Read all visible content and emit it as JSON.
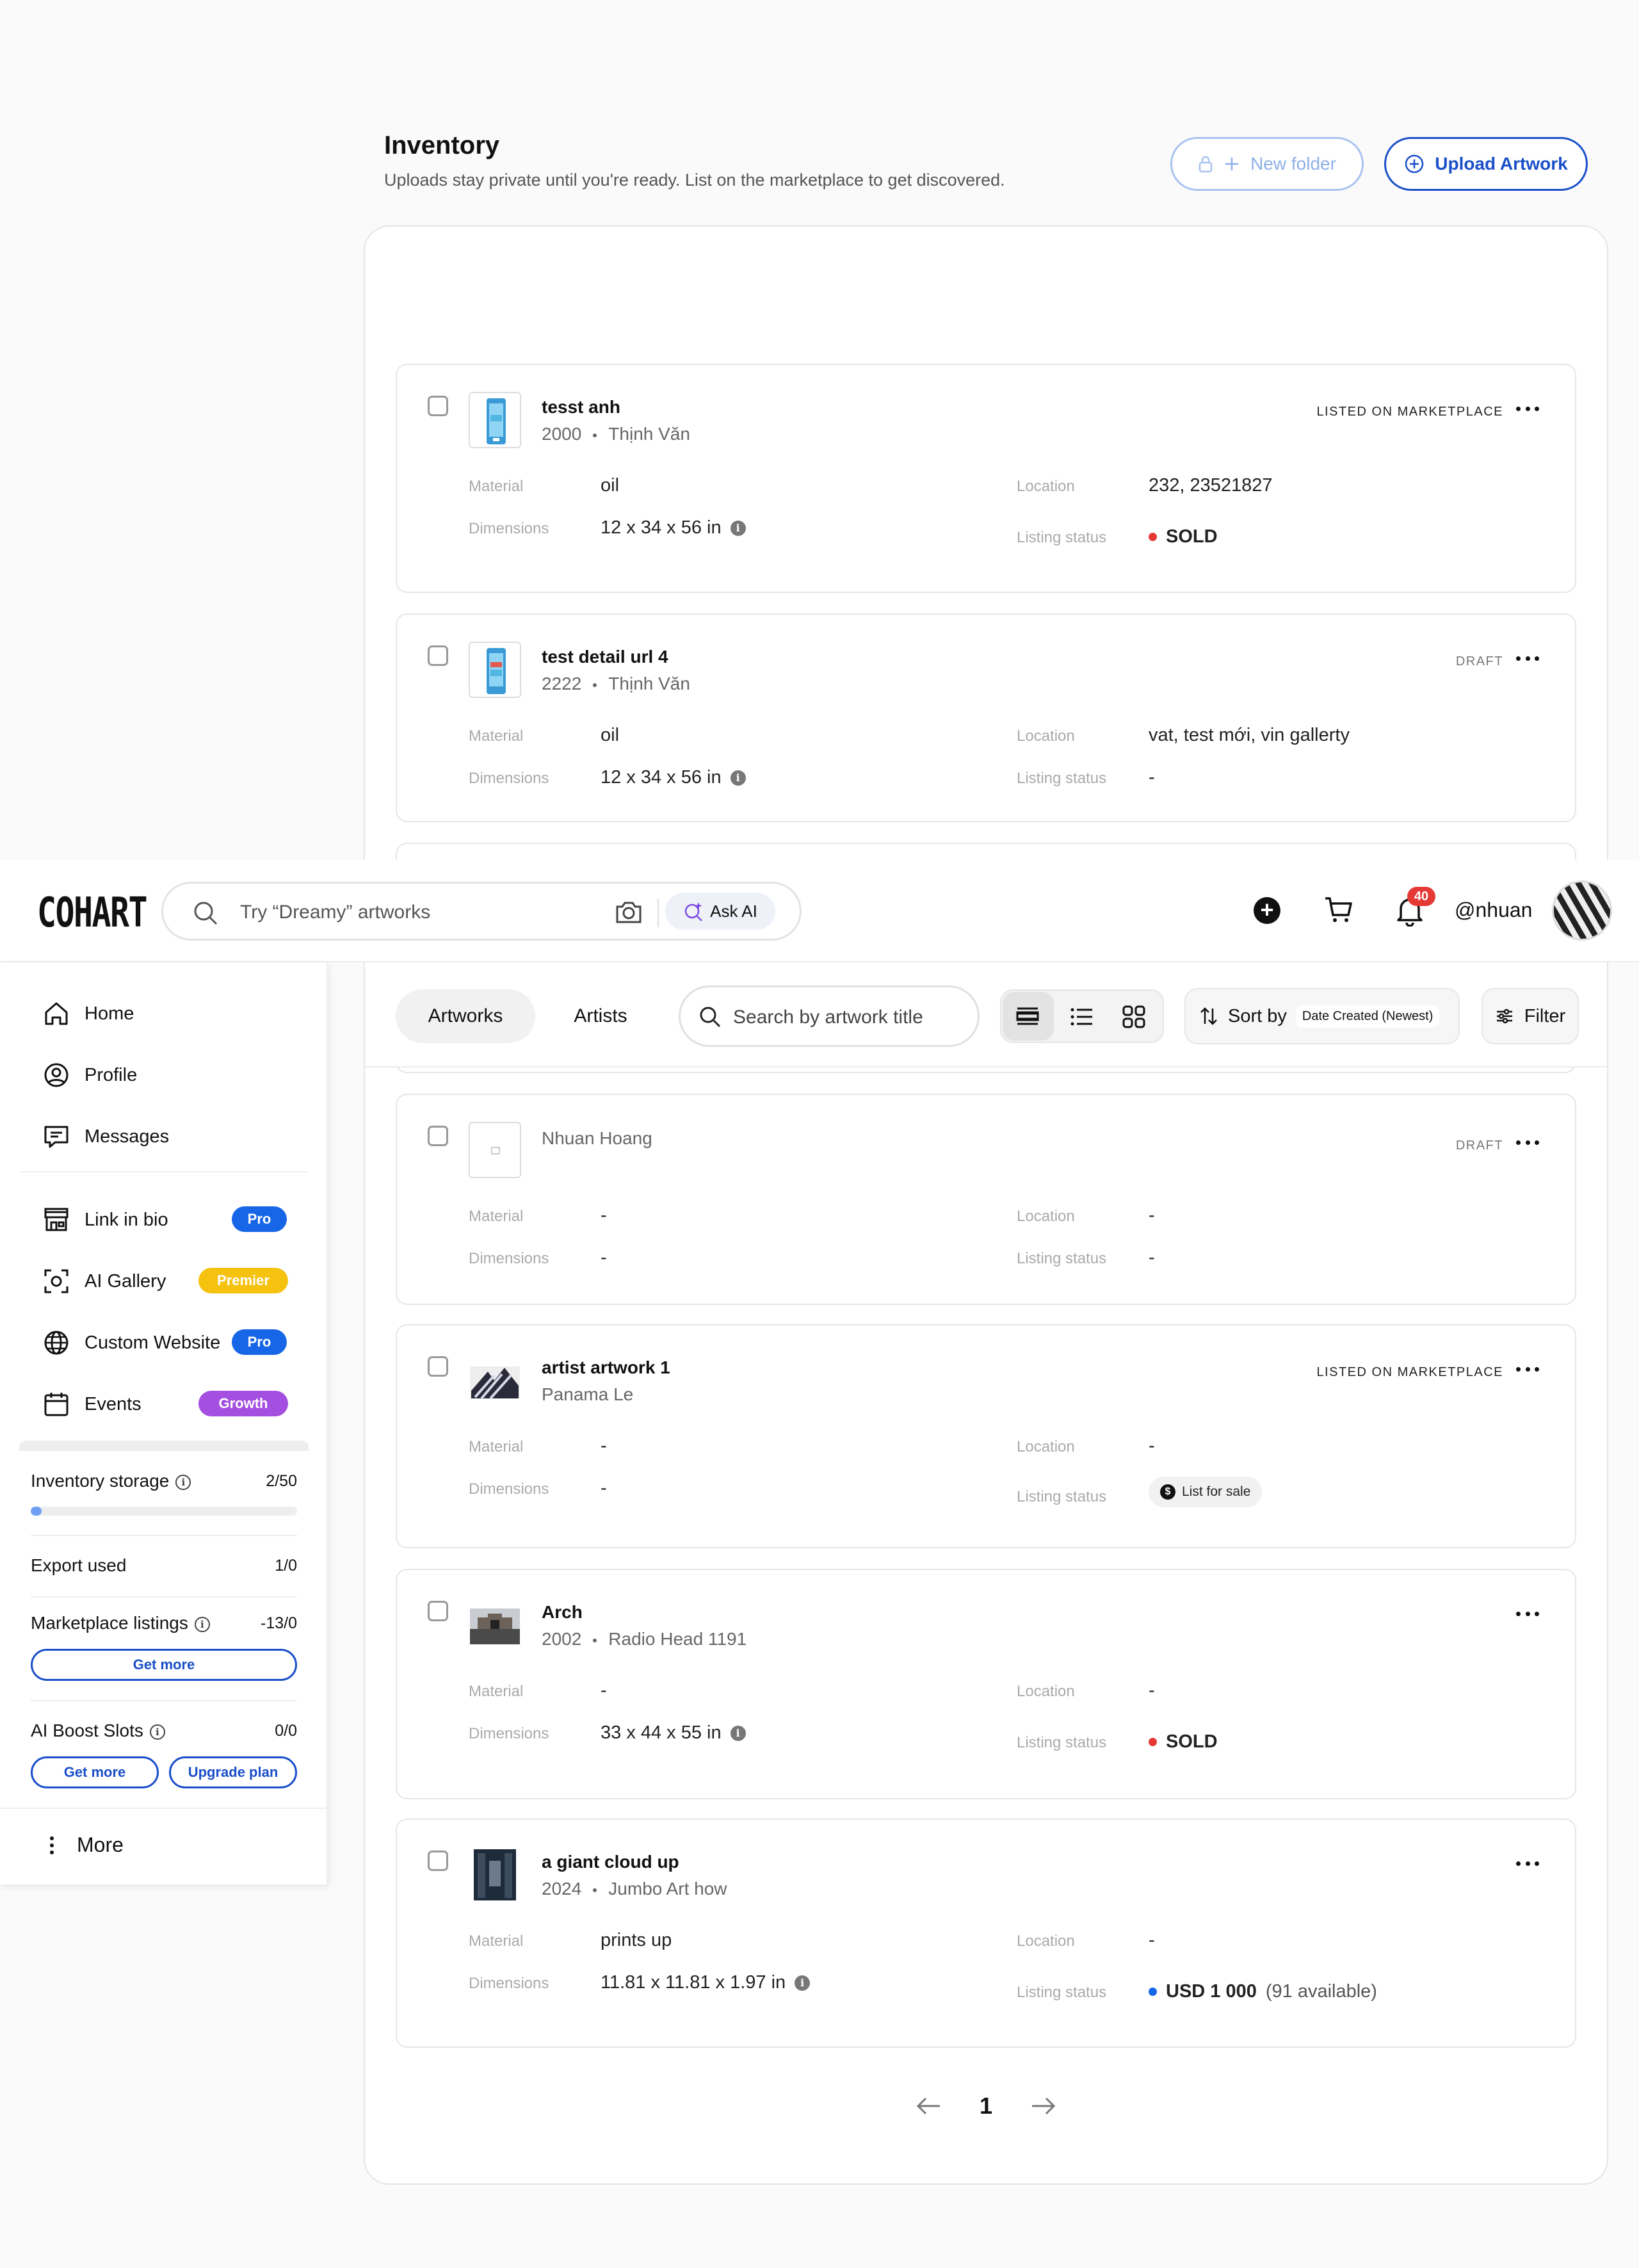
{
  "inventory": {
    "title": "Inventory",
    "subtitle": "Uploads stay private until you're ready. List on the marketplace to get discovered.",
    "new_folder_label": "New folder",
    "upload_label": "Upload Artwork"
  },
  "topnav": {
    "logo": "COHART",
    "search_placeholder": "Try “Dreamy” artworks",
    "ask_ai_label": "Ask AI",
    "notification_count": "40",
    "username": "@nhuan"
  },
  "sidebar": {
    "nav": [
      {
        "label": "Home"
      },
      {
        "label": "Profile"
      },
      {
        "label": "Messages"
      },
      {
        "label": "Link in bio",
        "badge": "Pro"
      },
      {
        "label": "AI Gallery",
        "badge": "Premier"
      },
      {
        "label": "Custom Website",
        "badge": "Pro"
      },
      {
        "label": "Events",
        "badge": "Growth"
      }
    ],
    "usage": {
      "storage_label": "Inventory storage",
      "storage_count": "2/50",
      "storage_fraction": 0.04,
      "export_label": "Export used",
      "export_count": "1/0",
      "listings_label": "Marketplace listings",
      "listings_count": "-13/0",
      "get_more_label": "Get more",
      "boost_label": "AI Boost Slots",
      "boost_count": "0/0",
      "boost_get_more_label": "Get more",
      "upgrade_label": "Upgrade plan"
    },
    "more_label": "More"
  },
  "filterbar": {
    "tab_artworks": "Artworks",
    "tab_artists": "Artists",
    "search_placeholder": "Search by artwork title",
    "sort_label": "Sort by",
    "sort_value": "Date Created (Newest)",
    "filter_label": "Filter"
  },
  "labels": {
    "material": "Material",
    "dimensions": "Dimensions",
    "location": "Location",
    "listing_status": "Listing status"
  },
  "artworks": [
    {
      "title": "tesst anh",
      "year": "2000",
      "artist": "Thịnh Văn",
      "status": "LISTED ON MARKETPLACE",
      "material": "oil",
      "dimensions": "12 x 34 x 56 in",
      "location": "232, 23521827",
      "listing": "SOLD"
    },
    {
      "title": "test detail url 4",
      "year": "2222",
      "artist": "Thịnh Văn",
      "status": "DRAFT",
      "material": "oil",
      "dimensions": "12 x 34 x 56 in",
      "location": "vat, test mới, vin gallerty",
      "listing": "-"
    },
    {
      "title": "",
      "artist": "Nhuan Hoang",
      "status": "DRAFT",
      "material": "-",
      "dimensions": "-",
      "location": "-",
      "listing": "-"
    },
    {
      "title": "artist artwork 1",
      "artist": "Panama Le",
      "status": "LISTED ON MARKETPLACE",
      "material": "-",
      "dimensions": "-",
      "location": "-",
      "listing": "List for sale"
    },
    {
      "title": "Arch",
      "year": "2002",
      "artist": "Radio Head 1191",
      "material": "-",
      "dimensions": "33 x 44 x 55 in",
      "location": "-",
      "listing": "SOLD"
    },
    {
      "title": "a giant cloud up",
      "year": "2024",
      "artist": "Jumbo Art how",
      "material": "prints up",
      "dimensions": "11.81 x 11.81 x 1.97 in",
      "location": "-",
      "listing": "USD 1 000",
      "listing_extra": "(91 available)"
    }
  ],
  "pagination": {
    "page": "1"
  },
  "colors": {
    "accent": "#1a4fc9",
    "sold": "#e53935",
    "price": "#1766e8",
    "pro": "#1766e8",
    "premier": "#f5c210",
    "growth": "#a44fe0"
  }
}
